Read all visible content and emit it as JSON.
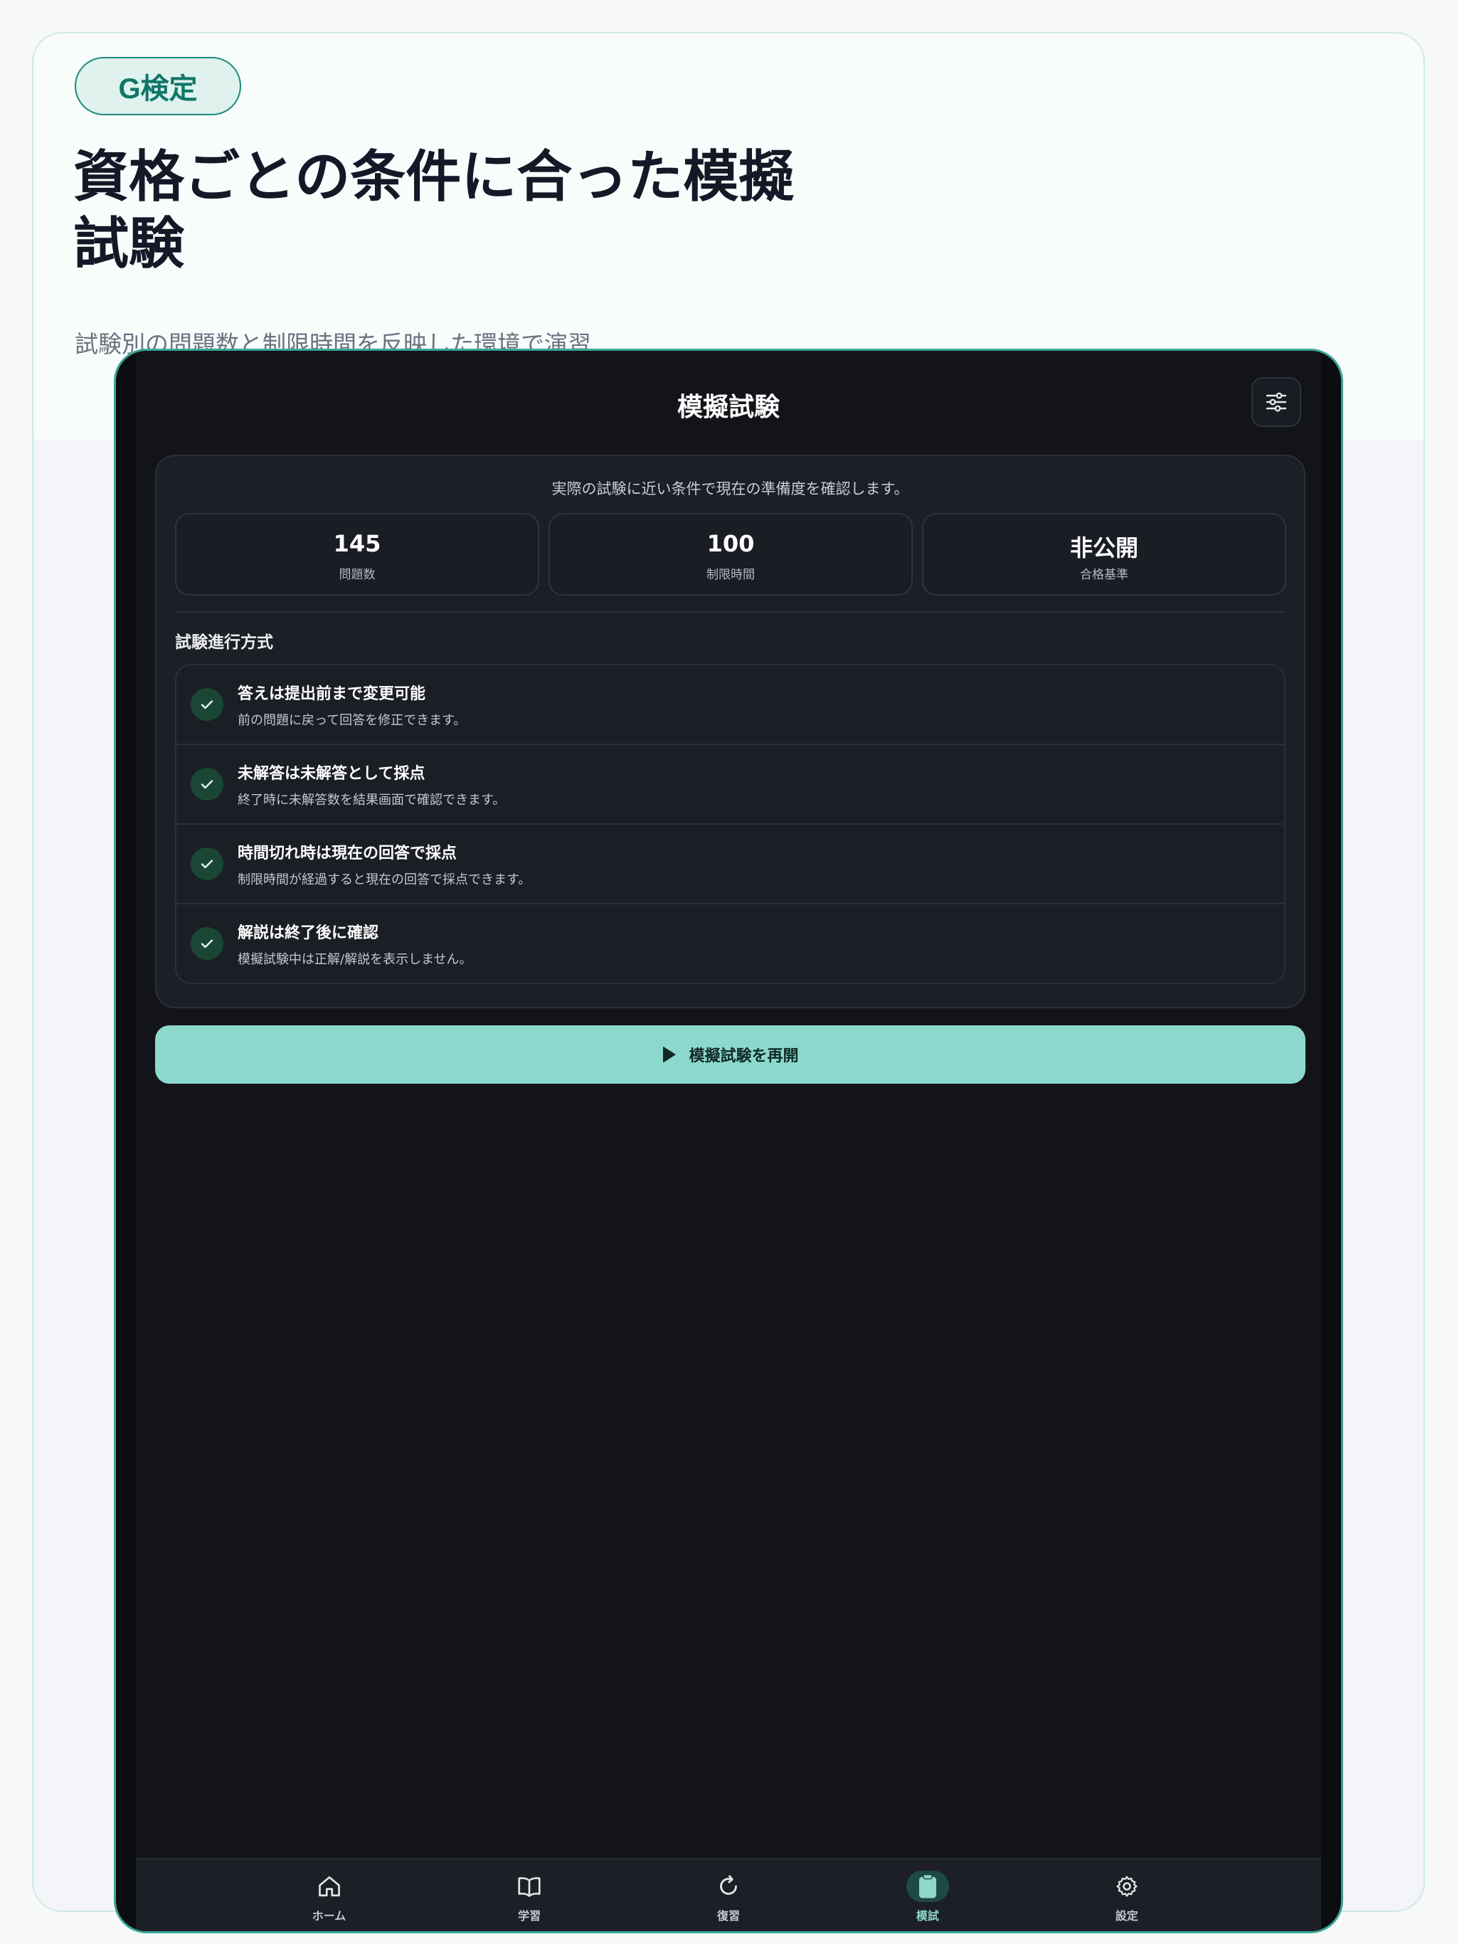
{
  "promo": {
    "badge": "G検定",
    "headline": "資格ごとの条件に合った模擬試験",
    "subline": "試験別の問題数と制限時間を反映した環境で演習"
  },
  "app": {
    "title": "模擬試験",
    "filter_icon": "sliders-icon",
    "intro": "実際の試験に近い条件で現在の準備度を確認します。",
    "stats": [
      {
        "value": "145",
        "label": "問題数"
      },
      {
        "value": "100",
        "label": "制限時間"
      },
      {
        "value": "非公開",
        "label": "合格基準"
      }
    ],
    "section_title": "試験進行方式",
    "rules": [
      {
        "title": "答えは提出前まで変更可能",
        "desc": "前の問題に戻って回答を修正できます。"
      },
      {
        "title": "未解答は未解答として採点",
        "desc": "終了時に未解答数を結果画面で確認できます。"
      },
      {
        "title": "時間切れ時は現在の回答で採点",
        "desc": "制限時間が経過すると現在の回答で採点できます。"
      },
      {
        "title": "解説は終了後に確認",
        "desc": "模擬試験中は正解/解説を表示しません。"
      }
    ],
    "resume_button": "模擬試験を再開",
    "tabs": [
      {
        "label": "ホーム",
        "icon": "home-icon",
        "active": false
      },
      {
        "label": "学習",
        "icon": "book-icon",
        "active": false
      },
      {
        "label": "復習",
        "icon": "refresh-icon",
        "active": false
      },
      {
        "label": "模試",
        "icon": "clipboard-icon",
        "active": true
      },
      {
        "label": "設定",
        "icon": "gear-icon",
        "active": false
      }
    ],
    "colors": {
      "accent": "#8dd8cc",
      "background": "#121419",
      "card": "#1c1f26",
      "check_bg": "#1a4636"
    }
  }
}
